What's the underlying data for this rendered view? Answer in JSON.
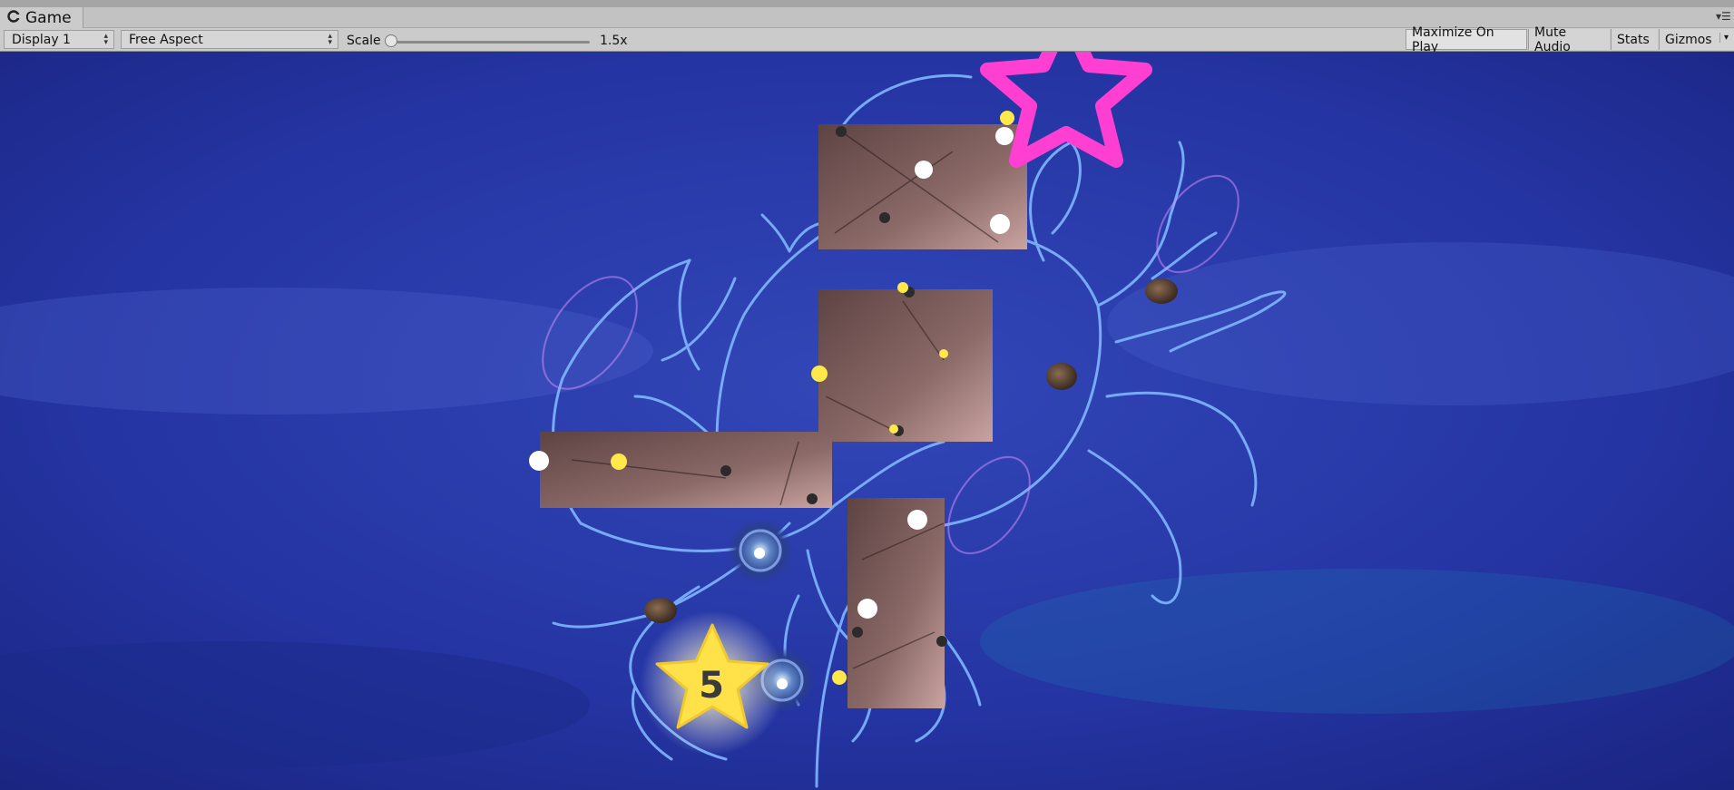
{
  "window": {
    "tab_title": "Game"
  },
  "toolbar": {
    "display_label": "Display 1",
    "aspect_label": "Free Aspect",
    "scale_label": "Scale",
    "scale_value": "1.5x",
    "scale_fraction": 0.0,
    "maximize_label": "Maximize On Play",
    "mute_label": "Mute Audio",
    "stats_label": "Stats",
    "gizmos_label": "Gizmos"
  },
  "game": {
    "level_number": "5",
    "colors": {
      "background": "#2a3aa8",
      "constellation_line": "#7fb6ff",
      "goal_star": "#ff3fd2",
      "level_star": "#ffe14a",
      "tile": "#8a6a68"
    }
  }
}
